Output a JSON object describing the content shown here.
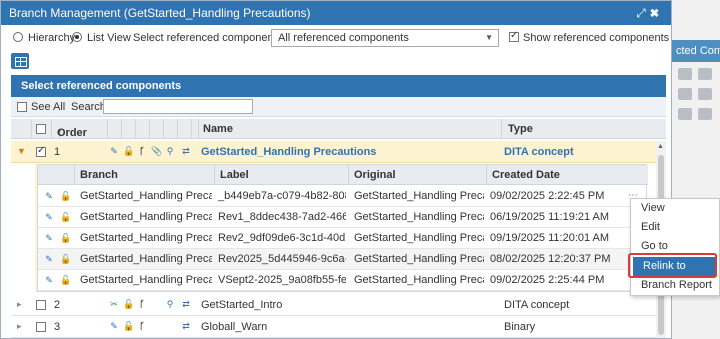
{
  "dialog": {
    "title": "Branch Management (GetStarted_Handling Precautions)",
    "expand_icon": "expand-icon",
    "close_icon": "close-icon"
  },
  "background_panel": {
    "header_text": "cted Compo"
  },
  "toolbar": {
    "hierarchy_label": "Hierarchy",
    "list_view_label": "List View",
    "select_label": "Select referenced components:",
    "required_mark": "*",
    "select_value": "All referenced components",
    "show_label": "Show referenced components"
  },
  "panel": {
    "title": "Select referenced components",
    "see_all_label": "See All",
    "search_label": "Search:",
    "search_value": ""
  },
  "columns": {
    "order": "Order",
    "sort_icon": "↑",
    "name": "Name",
    "type": "Type"
  },
  "rows": [
    {
      "order": "1",
      "name": "GetStarted_Handling Precautions",
      "type": "DITA concept"
    },
    {
      "order": "2",
      "name": "GetStarted_Intro",
      "type": "DITA concept"
    },
    {
      "order": "3",
      "name": "Globall_Warn",
      "type": "Binary"
    }
  ],
  "inner_columns": {
    "branch": "Branch",
    "label": "Label",
    "original": "Original",
    "created": "Created Date"
  },
  "inner_rows": [
    {
      "branch": "GetStarted_Handling Precautio...",
      "label": "_b449eb7a-c079-4b82-8085-6c...",
      "original": "GetStarted_Handling Precautio...",
      "created": "09/02/2025 2:22:45 PM"
    },
    {
      "branch": "GetStarted_Handling Precautio...",
      "label": "Rev1_8ddec438-7ad2-4668-b75...",
      "original": "GetStarted_Handling Precautio...",
      "created": "06/19/2025 11:19:21 AM"
    },
    {
      "branch": "GetStarted_Handling Precautio...",
      "label": "Rev2_9df09de6-3c1d-40db-944...",
      "original": "GetStarted_Handling Precautio...",
      "created": "09/19/2025 11:20:01 AM"
    },
    {
      "branch": "GetStarted_Handling Precautio...",
      "label": "Rev2025_5d445946-9c6a-4612-...",
      "original": "GetStarted_Handling Precautio...",
      "created": "08/02/2025 12:20:37 PM"
    },
    {
      "branch": "GetStarted_Handling Precautio...",
      "label": "VSept2-2025_9a08fb55-fec4-4d...",
      "original": "GetStarted_Handling Precautio...",
      "created": "09/02/2025 2:25:44 PM"
    }
  ],
  "context_menu": {
    "items": [
      "View",
      "Edit",
      "Go to",
      "Relink to Original",
      "Branch Report"
    ]
  },
  "colors": {
    "titlebar": "#2f73b0",
    "selected_row": "#fdf3d0",
    "highlight_outline": "#d93a3a"
  }
}
